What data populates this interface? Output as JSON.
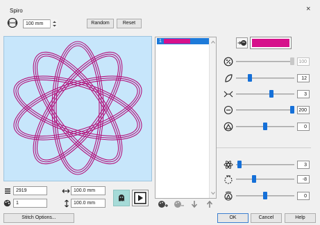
{
  "dialog": {
    "title": "Spiro",
    "close_icon": "×"
  },
  "size": {
    "value": "100 mm"
  },
  "buttons": {
    "random": "Random",
    "reset": "Reset",
    "stitch_options": "Stitch Options...",
    "ok": "OK",
    "cancel": "Cancel",
    "help": "Help"
  },
  "info": {
    "stitches": "2919",
    "width": "100.0 mm",
    "colors": "1",
    "height": "100.0 mm"
  },
  "color_list": {
    "items": [
      {
        "index": "1",
        "color": "#d6118b"
      }
    ]
  },
  "current_color": "#d6118b",
  "spiro_color": "#b3107a",
  "sliders": [
    {
      "name": "slider-percent",
      "icon": "percent-icon",
      "value": "100",
      "level": 1.0,
      "disabled": true
    },
    {
      "name": "slider-petal",
      "icon": "petal-icon",
      "value": "12",
      "level": 0.22
    },
    {
      "name": "slider-twist",
      "icon": "twist-icon",
      "value": "3",
      "level": 0.62
    },
    {
      "name": "slider-offset",
      "icon": "offset-icon",
      "value": "200",
      "level": 1.0
    },
    {
      "name": "slider-angle",
      "icon": "angle-icon",
      "value": "0",
      "level": 0.5
    },
    {
      "name": "slider-flower",
      "icon": "flower-icon",
      "value": "3",
      "level": 0.03
    },
    {
      "name": "slider-radius",
      "icon": "radius-icon",
      "value": "-8",
      "level": 0.3
    },
    {
      "name": "slider-rotate",
      "icon": "rotate-icon",
      "value": "0",
      "level": 0.5
    }
  ]
}
